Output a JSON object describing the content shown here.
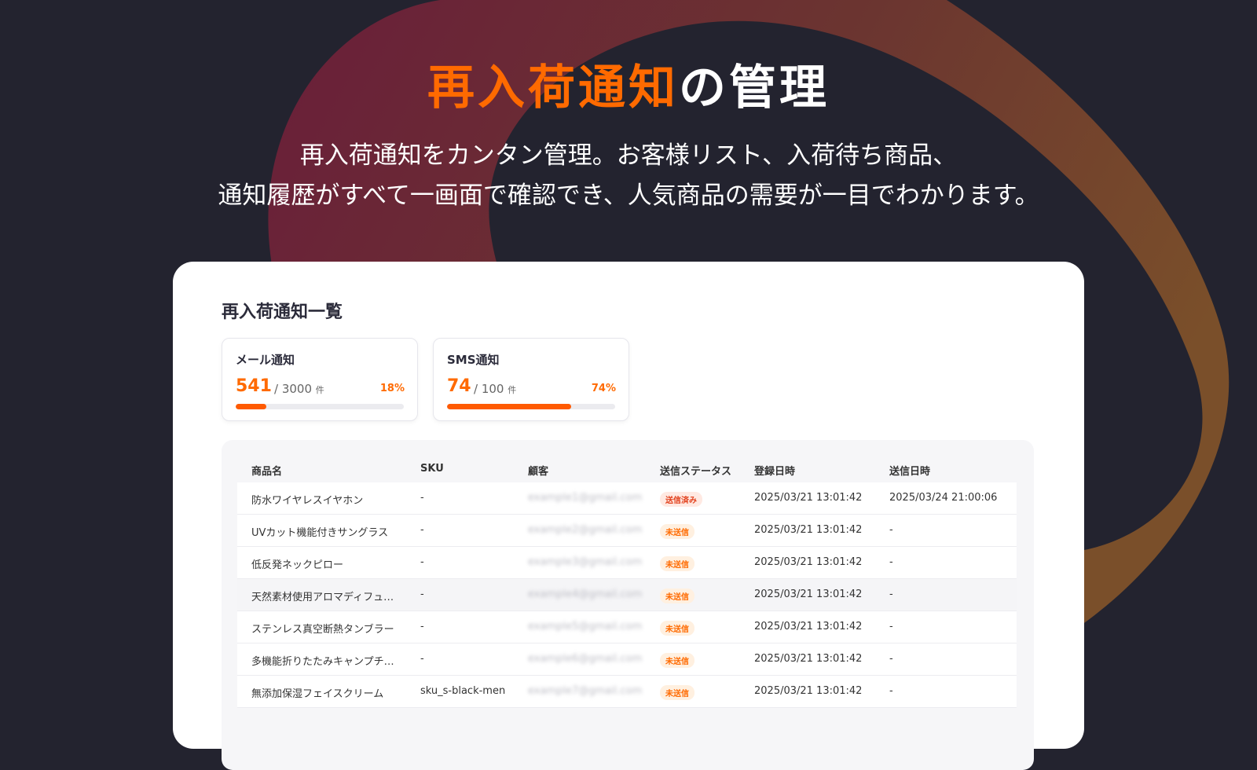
{
  "hero": {
    "title_accent": "再入荷通知",
    "title_rest": "の管理",
    "subtitle_line1": "再入荷通知をカンタン管理。お客様リスト、入荷待ち商品、",
    "subtitle_line2": "通知履歴がすべて一画面で確認でき、人気商品の需要が一目でわかります。"
  },
  "colors": {
    "background": "#23232f",
    "accent": "#ff6a00",
    "gradient_start": "#6a1e3a",
    "gradient_end": "#7a4f2a"
  },
  "panel": {
    "title": "再入荷通知一覧",
    "cards": [
      {
        "label": "メール通知",
        "count": "541",
        "total": "/ 3000",
        "unit": "件",
        "percent": "18%",
        "fill": 0.18
      },
      {
        "label": "SMS通知",
        "count": "74",
        "total": "/ 100",
        "unit": "件",
        "percent": "74%",
        "fill": 0.74
      }
    ]
  },
  "table": {
    "headers": [
      "商品名",
      "SKU",
      "顧客",
      "送信ステータス",
      "登録日時",
      "送信日時"
    ],
    "rows": [
      {
        "product": "防水ワイヤレスイヤホン",
        "sku": "-",
        "customer": "example1@gmail.com",
        "status": "送信済み",
        "registered": "2025/03/21 13:01:42",
        "sent": "2025/03/24 21:00:06"
      },
      {
        "product": "UVカット機能付きサングラス",
        "sku": "-",
        "customer": "example2@gmail.com",
        "status": "未送信",
        "registered": "2025/03/21 13:01:42",
        "sent": "-"
      },
      {
        "product": "低反発ネックピロー",
        "sku": "-",
        "customer": "example3@gmail.com",
        "status": "未送信",
        "registered": "2025/03/21 13:01:42",
        "sent": "-"
      },
      {
        "product": "天然素材使用アロマディフュー…",
        "sku": "-",
        "customer": "example4@gmail.com",
        "status": "未送信",
        "registered": "2025/03/21 13:01:42",
        "sent": "-"
      },
      {
        "product": "ステンレス真空断熱タンブラー",
        "sku": "-",
        "customer": "example5@gmail.com",
        "status": "未送信",
        "registered": "2025/03/21 13:01:42",
        "sent": "-"
      },
      {
        "product": "多機能折りたたみキャンプチェア",
        "sku": "-",
        "customer": "example6@gmail.com",
        "status": "未送信",
        "registered": "2025/03/21 13:01:42",
        "sent": "-"
      },
      {
        "product": "無添加保湿フェイスクリーム",
        "sku": "sku_s-black-men",
        "customer": "example7@gmail.com",
        "status": "未送信",
        "registered": "2025/03/21 13:01:42",
        "sent": "-"
      }
    ]
  }
}
